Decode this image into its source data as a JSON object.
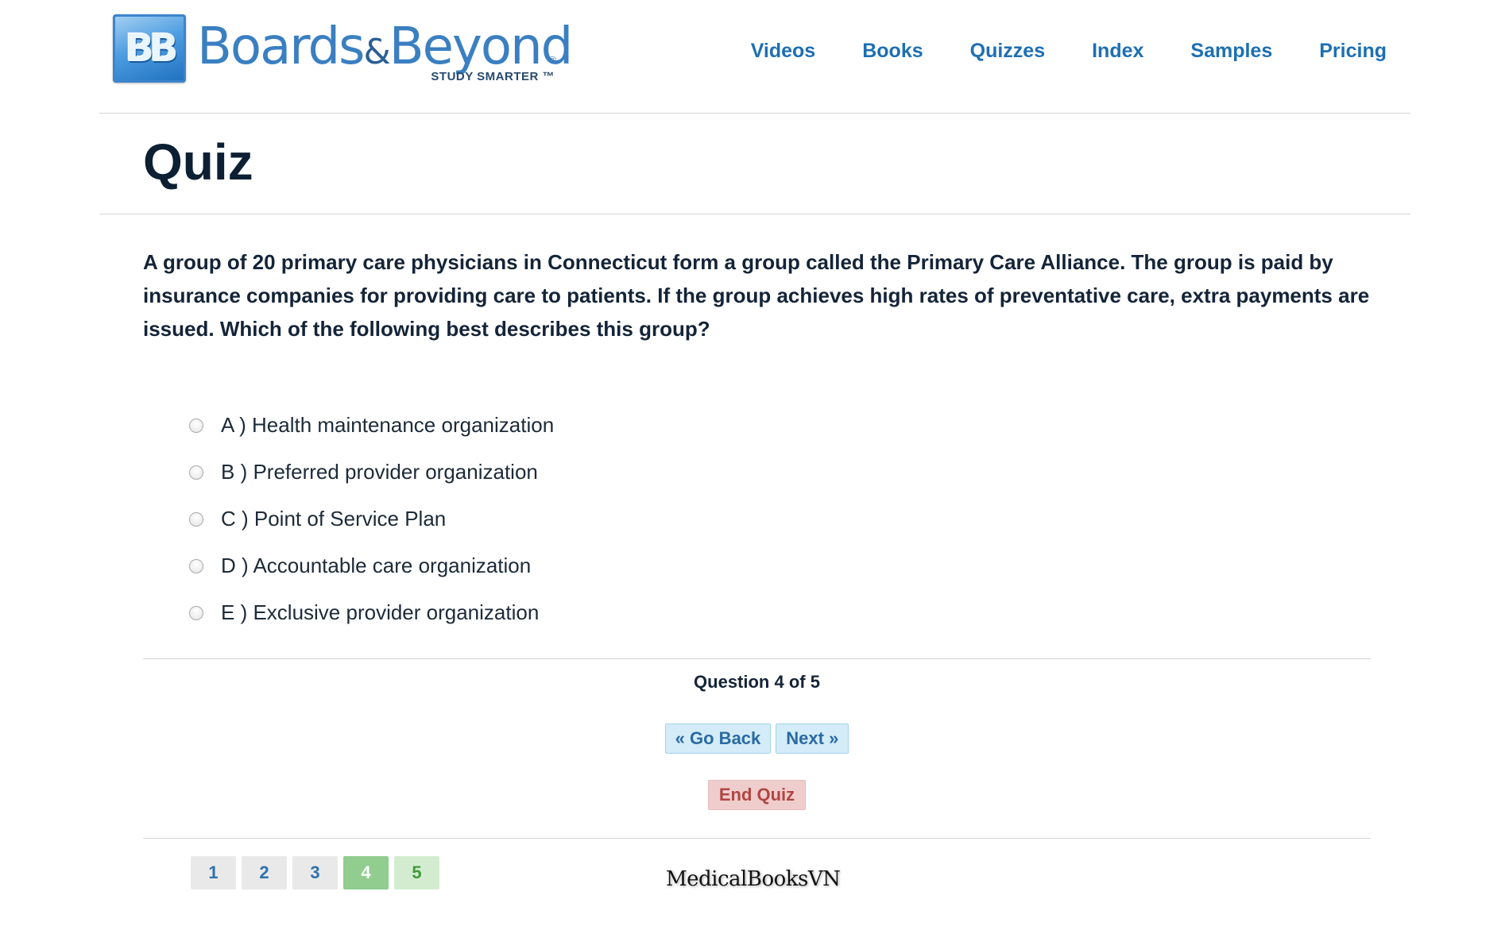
{
  "header": {
    "logo": {
      "monogram": "BB",
      "brand_part1": "Boards",
      "amp": "&",
      "brand_part2": "Beyond",
      "reg": "®",
      "tagline": "STUDY SMARTER ™"
    },
    "nav": [
      "Videos",
      "Books",
      "Quizzes",
      "Index",
      "Samples",
      "Pricing"
    ]
  },
  "page_title": "Quiz",
  "question": "A group of 20 primary care physicians in Connecticut form a group called the Primary Care Alliance. The group is paid by insurance companies for providing care to patients. If the group achieves high rates of preventative care, extra payments are issued. Which of the following best describes this group?",
  "answers": [
    "A ) Health maintenance organization",
    "B ) Preferred provider organization",
    "C ) Point of Service Plan",
    "D ) Accountable care organization",
    "E ) Exclusive provider organization"
  ],
  "progress": {
    "text": "Question 4 of 5",
    "current": 4,
    "total": 5
  },
  "buttons": {
    "back": "« Go Back",
    "next": "Next »",
    "end": "End Quiz"
  },
  "pagination": [
    {
      "label": "1",
      "state": "default"
    },
    {
      "label": "2",
      "state": "default"
    },
    {
      "label": "3",
      "state": "default"
    },
    {
      "label": "4",
      "state": "current"
    },
    {
      "label": "5",
      "state": "visited"
    }
  ],
  "watermark": "MedicalBooksVN",
  "colors": {
    "link": "#1d6fb3",
    "title": "#0c1f33",
    "nav_button_bg": "#d3ecf8",
    "end_button_bg": "#f0cdcd",
    "current_page": "#90cd8f",
    "visited_page": "#d3ecd0"
  }
}
